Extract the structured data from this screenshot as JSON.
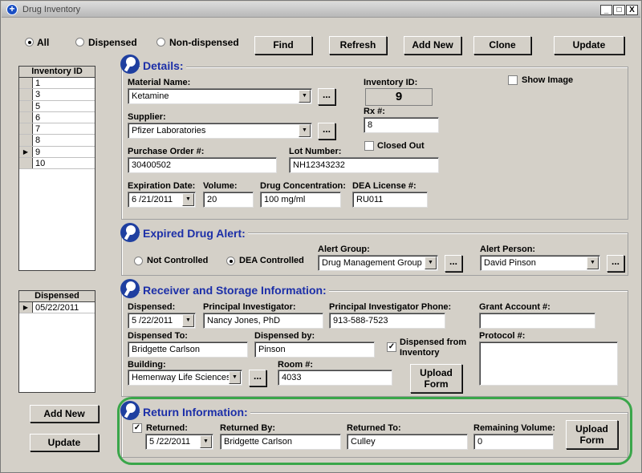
{
  "window": {
    "title": "Drug Inventory",
    "min": "_",
    "max": "□",
    "close": "X"
  },
  "filters": {
    "all": "All",
    "dispensed": "Dispensed",
    "non_dispensed": "Non-dispensed"
  },
  "toolbar": {
    "find": "Find",
    "refresh": "Refresh",
    "add_new": "Add New",
    "clone": "Clone",
    "update": "Update"
  },
  "inventory_grid": {
    "header": "Inventory ID",
    "rows": [
      "1",
      "3",
      "5",
      "6",
      "7",
      "8",
      "9",
      "10"
    ],
    "selected": "9"
  },
  "details": {
    "title": "Details:",
    "material_name_label": "Material Name:",
    "material_name": "Ketamine",
    "supplier_label": "Supplier:",
    "supplier": "Pfizer Laboratories",
    "inventory_id_label": "Inventory ID:",
    "inventory_id": "9",
    "rx_label": "Rx #:",
    "rx": "8",
    "closed_out_label": "Closed Out",
    "show_image_label": "Show Image",
    "po_label": "Purchase Order #:",
    "po": "30400502",
    "lot_label": "Lot Number:",
    "lot": "NH12343232",
    "exp_label": "Expiration Date:",
    "exp": "6 /21/2011",
    "volume_label": "Volume:",
    "volume": "20",
    "conc_label": "Drug Concentration:",
    "conc": "100 mg/ml",
    "dea_label": "DEA License #:",
    "dea": "RU011",
    "dots": "..."
  },
  "expired": {
    "title": "Expired Drug Alert:",
    "not_controlled": "Not Controlled",
    "dea_controlled": "DEA Controlled",
    "alert_group_label": "Alert Group:",
    "alert_group": "Drug Management Group",
    "alert_person_label": "Alert Person:",
    "alert_person": "David Pinson"
  },
  "dispensed_grid": {
    "header": "Dispensed",
    "rows": [
      "05/22/2011"
    ]
  },
  "receiver": {
    "title": "Receiver and Storage Information:",
    "dispensed_label": "Dispensed:",
    "dispensed": "5 /22/2011",
    "pi_label": "Principal Investigator:",
    "pi": "Nancy Jones, PhD",
    "pi_phone_label": "Principal Investigator Phone:",
    "pi_phone": "913-588-7523",
    "grant_label": "Grant Account #:",
    "grant": "",
    "dispensed_to_label": "Dispensed To:",
    "dispensed_to": "Bridgette Carlson",
    "dispensed_by_label": "Dispensed by:",
    "dispensed_by": "Pinson",
    "from_inventory_label": "Dispensed from Inventory",
    "protocol_label": "Protocol #:",
    "protocol": "",
    "building_label": "Building:",
    "building": "Hemenway Life Sciences",
    "room_label": "Room #:",
    "room": "4033",
    "upload_form": "Upload Form"
  },
  "left_buttons": {
    "add_new": "Add New",
    "update": "Update"
  },
  "return_info": {
    "title": "Return Information:",
    "returned_label": "Returned:",
    "returned": "5 /22/2011",
    "returned_by_label": "Returned By:",
    "returned_by": "Bridgette Carlson",
    "returned_to_label": "Returned To:",
    "returned_to": "Culley",
    "remaining_label": "Remaining Volume:",
    "remaining": "0",
    "upload_form": "Upload Form"
  }
}
